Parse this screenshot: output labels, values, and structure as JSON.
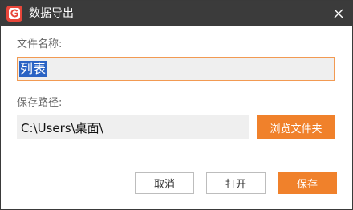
{
  "window": {
    "title": "数据导出",
    "close_icon": "close-icon",
    "app_icon": "app-logo-icon"
  },
  "file_name": {
    "label": "文件名称:",
    "value": "列表"
  },
  "save_path": {
    "label": "保存路径:",
    "value": "C:\\Users\\桌面\\",
    "browse_label": "浏览文件夹"
  },
  "actions": {
    "cancel_label": "取消",
    "open_label": "打开",
    "save_label": "保存"
  },
  "colors": {
    "accent": "#f0812b",
    "titlebar": "#3b3b3b",
    "selection": "#2a63c4",
    "field_bg": "#efefef"
  }
}
